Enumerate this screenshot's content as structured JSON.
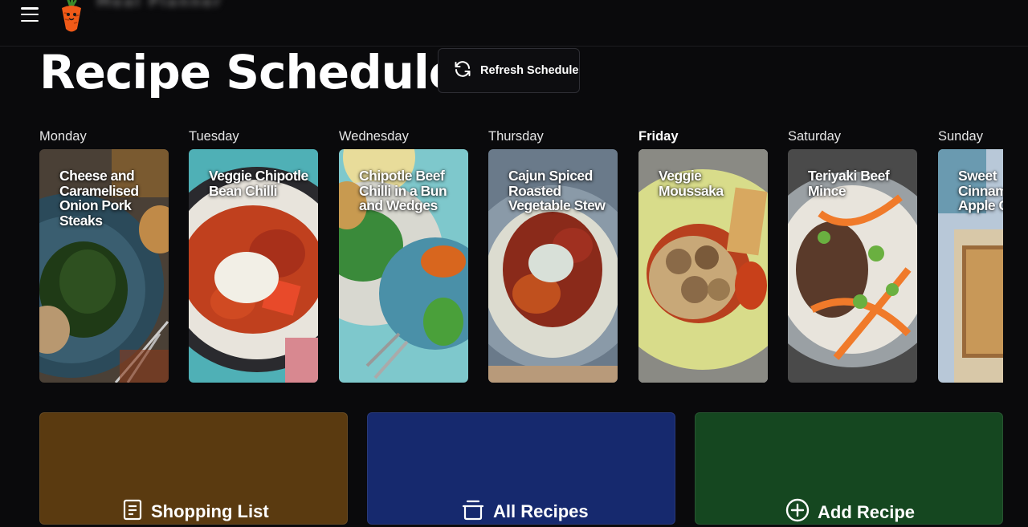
{
  "header": {
    "menu_icon": "hamburger-menu-icon",
    "logo_icon": "carrot-logo-icon",
    "brand": "Meal Planner"
  },
  "page": {
    "title": "Recipe Schedule",
    "refresh_label": "Refresh Schedule",
    "refresh_icon": "refresh-icon"
  },
  "schedule": [
    {
      "day": "Monday",
      "recipe": "Cheese and Caramelised Onion Pork Steaks",
      "active": false
    },
    {
      "day": "Tuesday",
      "recipe": "Veggie Chipotle Bean Chilli",
      "active": false
    },
    {
      "day": "Wednesday",
      "recipe": "Chipotle Beef Chilli in a Bun and Wedges",
      "active": false
    },
    {
      "day": "Thursday",
      "recipe": "Cajun Spiced Roasted Vegetable Stew",
      "active": false
    },
    {
      "day": "Friday",
      "recipe": "Veggie Moussaka",
      "active": true
    },
    {
      "day": "Saturday",
      "recipe": "Teriyaki Beef Mince",
      "active": false
    },
    {
      "day": "Sunday",
      "recipe": "Sweet Cinnamon Apple Crumble",
      "active": false
    }
  ],
  "tiles": [
    {
      "label": "Shopping List",
      "icon": "shopping-list-icon",
      "color": "#5a3a10"
    },
    {
      "label": "All Recipes",
      "icon": "cooking-pot-icon",
      "color": "#16296e"
    },
    {
      "label": "Add Recipe",
      "icon": "plus-circle-icon",
      "color": "#154720"
    }
  ]
}
